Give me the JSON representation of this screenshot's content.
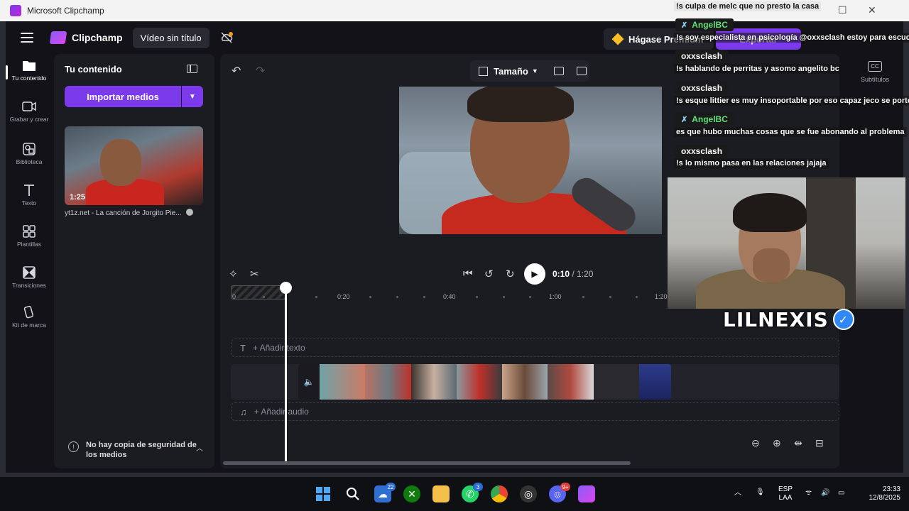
{
  "window": {
    "title": "Microsoft Clipchamp"
  },
  "topbar": {
    "brand": "Clipchamp",
    "doc_title": "Vídeo sin título",
    "premium_label": "Hágase Premium",
    "export_label": "Exportar"
  },
  "nav": [
    {
      "icon": "folder-icon",
      "label": "Tu contenido"
    },
    {
      "icon": "camera-icon",
      "label": "Grabar y crear"
    },
    {
      "icon": "library-icon",
      "label": "Biblioteca"
    },
    {
      "icon": "text-icon",
      "label": "Texto"
    },
    {
      "icon": "templates-icon",
      "label": "Plantillas"
    },
    {
      "icon": "transitions-icon",
      "label": "Transiciones"
    },
    {
      "icon": "brand-kit-icon",
      "label": "Kit de marca"
    }
  ],
  "panel": {
    "title": "Tu contenido",
    "import_label": "Importar medios",
    "media": {
      "duration": "1:25",
      "name": "yt1z.net - La canción de Jorgito Pie..."
    },
    "backup_text": "No hay copia de seguridad de los medios"
  },
  "editor": {
    "size_label": "Tamaño",
    "time_current": "0:10",
    "time_sep": " / ",
    "time_total": "1:20",
    "ruler": [
      "0",
      "0:20",
      "0:40",
      "1:00",
      "1:20"
    ],
    "add_text": "+ Añadir texto",
    "add_audio": "+ Añadir audio"
  },
  "right_rail": {
    "subtitles_label": "Subtítulos",
    "cc": "CC"
  },
  "chat": [
    {
      "type": "msg",
      "text": "!s culpa de melc que no presto la casa",
      "light": true
    },
    {
      "type": "user",
      "name": "AngelBC",
      "mod": true
    },
    {
      "type": "msg",
      "text": "!s soy especialista en psicología @oxxsclash estoy para escuche"
    },
    {
      "type": "user",
      "name": "oxxsclash",
      "mod": false
    },
    {
      "type": "msg",
      "text": "!s hablando de perritas y asomo angelito bc"
    },
    {
      "type": "user",
      "name": "oxxsclash",
      "mod": false
    },
    {
      "type": "msg",
      "text": "!s esque littier es muy insoportable por eso capaz jeco se portó a"
    },
    {
      "type": "user",
      "name": "AngelBC",
      "mod": true
    },
    {
      "type": "msg",
      "text": "es que hubo muchas cosas que se fue abonando al problema"
    },
    {
      "type": "user",
      "name": "oxxsclash",
      "mod": false
    },
    {
      "type": "msg",
      "text": "!s lo mismo pasa en las relaciones jajaja"
    }
  ],
  "overlay": {
    "streamer_name": "LILNEXIS",
    "badge": "✓"
  },
  "taskbar": {
    "badges": {
      "widgets": "22",
      "whatsapp": "3",
      "discord": "9+"
    },
    "lang_top": "ESP",
    "lang_bottom": "LAA",
    "time": "23:33",
    "date": "12/8/2025"
  },
  "colors": {
    "accent": "#7c3aed",
    "bg": "#121218",
    "panel": "#1b1b22"
  }
}
